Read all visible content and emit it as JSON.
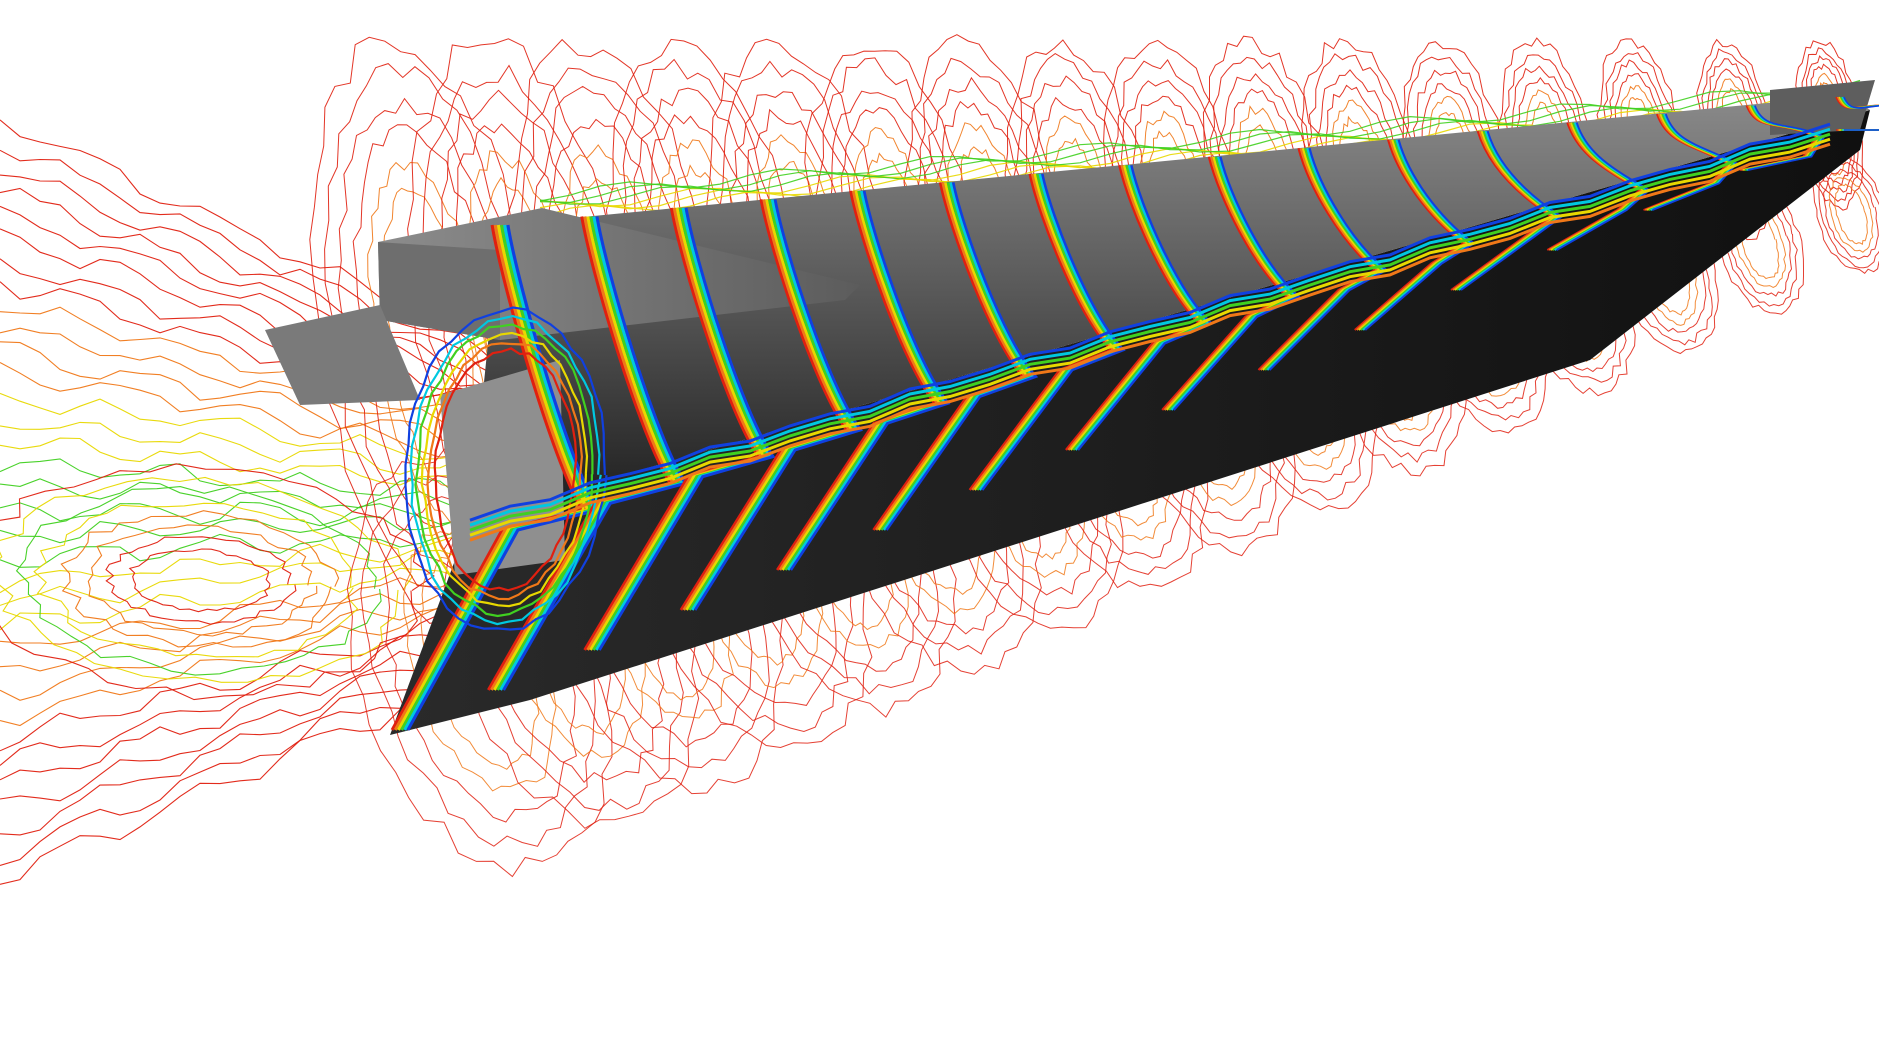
{
  "image": {
    "subject": "cfd-visualization",
    "background_color": "#ffffff",
    "colors": {
      "contour_outer": "#e02010",
      "contour_mid_orange": "#f07818",
      "contour_yellow": "#e8d800",
      "contour_green": "#40d020",
      "contour_cyan": "#00c8e0",
      "contour_blue": "#1040e0",
      "body_top": "#7a7a7a",
      "body_mid": "#4a4a4a",
      "body_bottom": "#1e1e1e"
    },
    "slice_count": 16
  }
}
